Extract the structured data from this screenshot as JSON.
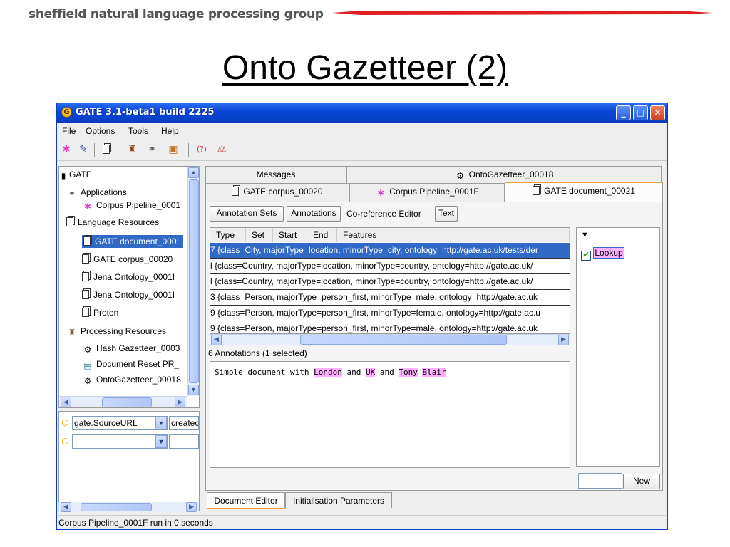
{
  "slide": {
    "header": "sheffield natural language processing group",
    "title": "Onto Gazetteer (2)",
    "accent": "#e02020"
  },
  "window": {
    "title": "GATE 3.1-beta1 build 2225",
    "menu": [
      "File",
      "Options",
      "Tools",
      "Help"
    ],
    "controls": {
      "minimize": "_",
      "maximize": "□",
      "close": "✕"
    }
  },
  "tree": {
    "root": "GATE",
    "applications_label": "Applications",
    "corpus_pipeline": "Corpus Pipeline_0001",
    "language_resources_label": "Language Resources",
    "language_resources": [
      "GATE document_000:",
      "GATE corpus_00020",
      "Jena Ontology_0001I",
      "Jena Ontology_0001I",
      "Proton"
    ],
    "processing_resources_label": "Processing Resources",
    "processing_resources": [
      "Hash Gazetteer_0003",
      "Document Reset PR_",
      "OntoGazetteer_00018"
    ]
  },
  "features": {
    "row1_key": "gate.SourceURL",
    "row1_value": "createc",
    "row2_key": ""
  },
  "status": "Corpus Pipeline_0001F run in 0 seconds",
  "tabs": {
    "row1": [
      "Messages",
      "OntoGazetteer_00018"
    ],
    "row2": [
      "GATE corpus_00020",
      "Corpus Pipeline_0001F",
      "GATE document_00021"
    ]
  },
  "view_buttons": [
    "Annotation Sets",
    "Annotations",
    "Co-reference Editor",
    "Text"
  ],
  "table": {
    "columns": [
      "Type",
      "Set",
      "Start",
      "End",
      "Features"
    ],
    "rows": [
      "{class=City, majorType=location, minorType=city, ontology=http://gate.ac.uk/tests/der",
      "{class=Country, majorType=location, minorType=country, ontology=http://gate.ac.uk/",
      "{class=Country, majorType=location, minorType=country, ontology=http://gate.ac.uk/",
      "{class=Person, majorType=person_first, minorType=male, ontology=http://gate.ac.uk",
      "{class=Person, majorType=person_first, minorType=female, ontology=http://gate.ac.u",
      "{class=Person, majorType=person_first, minorType=male, ontology=http://gate.ac.uk"
    ],
    "row_prefixes": [
      "7",
      "l",
      "l",
      "3",
      "9",
      "9"
    ],
    "summary": "6 Annotations (1 selected)"
  },
  "document": {
    "text_before": "Simple document with ",
    "london": "London",
    "and1": " and ",
    "uk": "UK",
    "and2": " and ",
    "tony": "Tony",
    "space": " ",
    "blair": "Blair"
  },
  "annotation_types": {
    "header_icon": "▼",
    "lookup": "Lookup",
    "new_button": "New"
  },
  "bottom_tabs": [
    "Document Editor",
    "Initialisation Parameters"
  ]
}
